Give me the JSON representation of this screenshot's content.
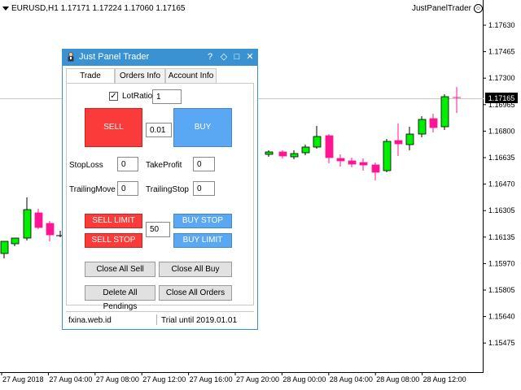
{
  "chart": {
    "symbol_line": "EURUSD,H1  1.17171 1.17224 1.17060 1.17165",
    "ea_name": "JustPanelTrader",
    "current_price": "1.17165",
    "price_labels": [
      "1.17630",
      "1.17465",
      "1.17300",
      "1.16965",
      "1.16800",
      "1.16635",
      "1.16470",
      "1.16305",
      "1.16135",
      "1.15970",
      "1.15805",
      "1.15640",
      "1.15475"
    ],
    "time_labels": [
      "27 Aug 2018",
      "27 Aug 04:00",
      "27 Aug 08:00",
      "27 Aug 12:00",
      "27 Aug 16:00",
      "27 Aug 20:00",
      "28 Aug 00:00",
      "28 Aug 04:00",
      "28 Aug 08:00",
      "28 Aug 12:00"
    ],
    "colors": {
      "bull": "#00ee00",
      "bear": "#ff1493",
      "current_price_bg": "#000000"
    }
  },
  "panel": {
    "title": "Just Panel Trader",
    "title_buttons": [
      "?",
      "◇",
      "□",
      "✕"
    ],
    "tabs": [
      "Trade",
      "Orders Info",
      "Account Info"
    ],
    "lot_ratio": {
      "label": "LotRatio",
      "checked": true,
      "value": "1"
    },
    "sell_label": "SELL",
    "buy_label": "BUY",
    "lot_value": "0.01",
    "stop_loss": {
      "label": "StopLoss",
      "value": "0"
    },
    "take_profit": {
      "label": "TakeProfit",
      "value": "0"
    },
    "trailing_move": {
      "label": "TrailingMove",
      "value": "0"
    },
    "trailing_stop": {
      "label": "TrailingStop",
      "value": "0"
    },
    "sell_limit_label": "SELL LIMIT",
    "sell_stop_label": "SELL STOP",
    "buy_stop_label": "BUY STOP",
    "buy_limit_label": "BUY LIMIT",
    "pending_distance": "50",
    "close_all_sell_label": "Close All Sell",
    "close_all_buy_label": "Close All Buy",
    "delete_pendings_label": "Delete All Pendings",
    "close_all_orders_label": "Close All Orders",
    "status_left": "fxina.web.id",
    "status_right": "Trial until 2019.01.01",
    "colors": {
      "title_bar": "#3a92d3",
      "sell": "#fb3a3a",
      "buy": "#5aa7f3"
    }
  }
}
